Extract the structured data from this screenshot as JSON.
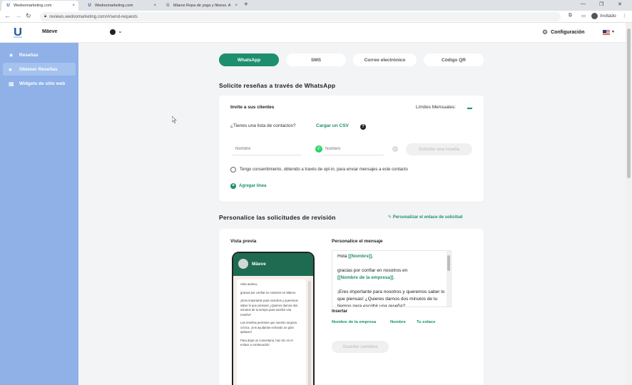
{
  "browser": {
    "tabs": [
      {
        "label": "Wedoomarketing.com",
        "close": "×"
      },
      {
        "label": "Wedoomarketing.com",
        "close": "×"
      },
      {
        "label": "Mäeve Ropa de yoga y fitness. A",
        "close": "×"
      }
    ],
    "new_tab": "+",
    "url": "reviews.wedoomarketing.com/#/send-requests",
    "profile_label": "Invitado",
    "window_controls": {
      "minimize": "—",
      "maximize": "❐",
      "close": "✕"
    }
  },
  "header": {
    "business_name": "Mäeve",
    "settings_label": "Configuración"
  },
  "sidebar": {
    "items": [
      {
        "icon": "star-icon",
        "label": "Reseñas"
      },
      {
        "icon": "comment-icon",
        "label": "Obtener Reseñas"
      },
      {
        "icon": "grid-icon",
        "label": "Widgets de sitio web"
      }
    ]
  },
  "channels": {
    "tabs": [
      {
        "label": "WhatsApp",
        "active": true
      },
      {
        "label": "SMS",
        "active": false
      },
      {
        "label": "Correo electrónico",
        "active": false
      },
      {
        "label": "Código QR",
        "active": false
      }
    ]
  },
  "request": {
    "title": "Solicite reseñas a través de WhatsApp",
    "invite_label": "Invite a sus clientes",
    "monthly_limits_label": "Límites Mensuales:",
    "contacts_question": "¿Tienes una lista de contactos?",
    "upload_csv": "Cargar un CSV",
    "help": "?",
    "name_placeholder": "Nombre",
    "number_placeholder": "Número",
    "request_button": "Solicitar una reseña",
    "consent_text": "Tengo consentimiento, obtenido a través de opt-in, para enviar mensajes a este contacto",
    "add_line": "Agregar línea"
  },
  "customize": {
    "title": "Personalice las solicitudes de revisión",
    "custom_link": "Personalizar el enlace de solicitud",
    "preview_label": "Vista previa",
    "message_label": "Personalice el mensaje",
    "phone": {
      "contact_name": "Mäeve",
      "paragraphs": [
        "Hola andrea,",
        "gracias por confiar en nosotros en Mäeve.",
        "¡Eres importante para nosotros y queremos saber lo que piensas! ¿Quieres darnos dos minutos de tu tiempo para escribir una reseña?",
        "Las reseñas permiten que nuestro negocio crezca, ¡nos ayudarías echando un gran aplauso!",
        "Para dejar un comentario, haz clic en el enlace a continuación:"
      ]
    },
    "message": {
      "greeting": "Hola",
      "name_token": "[[Nombre]]",
      "line2": "gracias por confiar en nosotros en",
      "company_token": "[[Nombre de la empresa]]",
      "line3": "¡Eres importante para nosotros y queremos saber lo que piensas! ¿Quieres darnos dos minutos de tu tiempo para escribir una reseña?"
    },
    "insert_label": "Insertar",
    "insert_items": [
      "Nombre de la empresa",
      "Nombre",
      "Tu enlace"
    ],
    "save_button": "Guardar cambios"
  },
  "colors": {
    "accent": "#1e8f6e",
    "sidebar": "#8fb1e8",
    "whatsapp": "#25d366"
  }
}
